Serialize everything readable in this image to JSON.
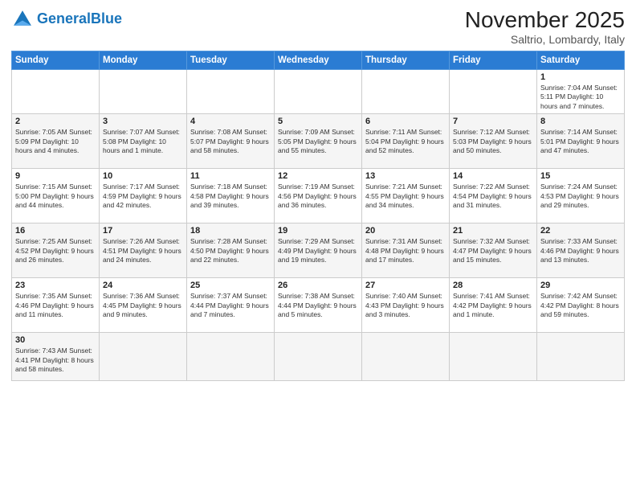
{
  "header": {
    "logo_general": "General",
    "logo_blue": "Blue",
    "title": "November 2025",
    "subtitle": "Saltrio, Lombardy, Italy"
  },
  "weekdays": [
    "Sunday",
    "Monday",
    "Tuesday",
    "Wednesday",
    "Thursday",
    "Friday",
    "Saturday"
  ],
  "weeks": [
    [
      {
        "day": null,
        "info": null
      },
      {
        "day": null,
        "info": null
      },
      {
        "day": null,
        "info": null
      },
      {
        "day": null,
        "info": null
      },
      {
        "day": null,
        "info": null
      },
      {
        "day": null,
        "info": null
      },
      {
        "day": "1",
        "info": "Sunrise: 7:04 AM\nSunset: 5:11 PM\nDaylight: 10 hours\nand 7 minutes."
      }
    ],
    [
      {
        "day": "2",
        "info": "Sunrise: 7:05 AM\nSunset: 5:09 PM\nDaylight: 10 hours\nand 4 minutes."
      },
      {
        "day": "3",
        "info": "Sunrise: 7:07 AM\nSunset: 5:08 PM\nDaylight: 10 hours\nand 1 minute."
      },
      {
        "day": "4",
        "info": "Sunrise: 7:08 AM\nSunset: 5:07 PM\nDaylight: 9 hours\nand 58 minutes."
      },
      {
        "day": "5",
        "info": "Sunrise: 7:09 AM\nSunset: 5:05 PM\nDaylight: 9 hours\nand 55 minutes."
      },
      {
        "day": "6",
        "info": "Sunrise: 7:11 AM\nSunset: 5:04 PM\nDaylight: 9 hours\nand 52 minutes."
      },
      {
        "day": "7",
        "info": "Sunrise: 7:12 AM\nSunset: 5:03 PM\nDaylight: 9 hours\nand 50 minutes."
      },
      {
        "day": "8",
        "info": "Sunrise: 7:14 AM\nSunset: 5:01 PM\nDaylight: 9 hours\nand 47 minutes."
      }
    ],
    [
      {
        "day": "9",
        "info": "Sunrise: 7:15 AM\nSunset: 5:00 PM\nDaylight: 9 hours\nand 44 minutes."
      },
      {
        "day": "10",
        "info": "Sunrise: 7:17 AM\nSunset: 4:59 PM\nDaylight: 9 hours\nand 42 minutes."
      },
      {
        "day": "11",
        "info": "Sunrise: 7:18 AM\nSunset: 4:58 PM\nDaylight: 9 hours\nand 39 minutes."
      },
      {
        "day": "12",
        "info": "Sunrise: 7:19 AM\nSunset: 4:56 PM\nDaylight: 9 hours\nand 36 minutes."
      },
      {
        "day": "13",
        "info": "Sunrise: 7:21 AM\nSunset: 4:55 PM\nDaylight: 9 hours\nand 34 minutes."
      },
      {
        "day": "14",
        "info": "Sunrise: 7:22 AM\nSunset: 4:54 PM\nDaylight: 9 hours\nand 31 minutes."
      },
      {
        "day": "15",
        "info": "Sunrise: 7:24 AM\nSunset: 4:53 PM\nDaylight: 9 hours\nand 29 minutes."
      }
    ],
    [
      {
        "day": "16",
        "info": "Sunrise: 7:25 AM\nSunset: 4:52 PM\nDaylight: 9 hours\nand 26 minutes."
      },
      {
        "day": "17",
        "info": "Sunrise: 7:26 AM\nSunset: 4:51 PM\nDaylight: 9 hours\nand 24 minutes."
      },
      {
        "day": "18",
        "info": "Sunrise: 7:28 AM\nSunset: 4:50 PM\nDaylight: 9 hours\nand 22 minutes."
      },
      {
        "day": "19",
        "info": "Sunrise: 7:29 AM\nSunset: 4:49 PM\nDaylight: 9 hours\nand 19 minutes."
      },
      {
        "day": "20",
        "info": "Sunrise: 7:31 AM\nSunset: 4:48 PM\nDaylight: 9 hours\nand 17 minutes."
      },
      {
        "day": "21",
        "info": "Sunrise: 7:32 AM\nSunset: 4:47 PM\nDaylight: 9 hours\nand 15 minutes."
      },
      {
        "day": "22",
        "info": "Sunrise: 7:33 AM\nSunset: 4:46 PM\nDaylight: 9 hours\nand 13 minutes."
      }
    ],
    [
      {
        "day": "23",
        "info": "Sunrise: 7:35 AM\nSunset: 4:46 PM\nDaylight: 9 hours\nand 11 minutes."
      },
      {
        "day": "24",
        "info": "Sunrise: 7:36 AM\nSunset: 4:45 PM\nDaylight: 9 hours\nand 9 minutes."
      },
      {
        "day": "25",
        "info": "Sunrise: 7:37 AM\nSunset: 4:44 PM\nDaylight: 9 hours\nand 7 minutes."
      },
      {
        "day": "26",
        "info": "Sunrise: 7:38 AM\nSunset: 4:44 PM\nDaylight: 9 hours\nand 5 minutes."
      },
      {
        "day": "27",
        "info": "Sunrise: 7:40 AM\nSunset: 4:43 PM\nDaylight: 9 hours\nand 3 minutes."
      },
      {
        "day": "28",
        "info": "Sunrise: 7:41 AM\nSunset: 4:42 PM\nDaylight: 9 hours\nand 1 minute."
      },
      {
        "day": "29",
        "info": "Sunrise: 7:42 AM\nSunset: 4:42 PM\nDaylight: 8 hours\nand 59 minutes."
      }
    ],
    [
      {
        "day": "30",
        "info": "Sunrise: 7:43 AM\nSunset: 4:41 PM\nDaylight: 8 hours\nand 58 minutes."
      },
      {
        "day": null,
        "info": null
      },
      {
        "day": null,
        "info": null
      },
      {
        "day": null,
        "info": null
      },
      {
        "day": null,
        "info": null
      },
      {
        "day": null,
        "info": null
      },
      {
        "day": null,
        "info": null
      }
    ]
  ]
}
